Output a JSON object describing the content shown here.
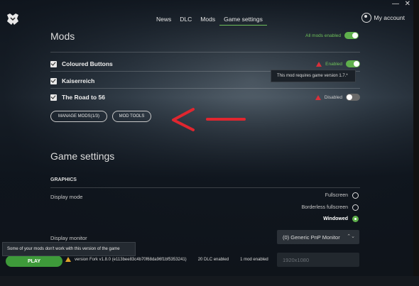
{
  "window": {
    "minimize": "—",
    "close": "✕"
  },
  "nav": {
    "items": [
      "News",
      "DLC",
      "Mods",
      "Game settings"
    ],
    "active": "Game settings",
    "account": "My account"
  },
  "mods": {
    "title": "Mods",
    "all_label": "All mods enabled",
    "list": [
      {
        "name": "Coloured Buttons",
        "status": "Enabled"
      },
      {
        "name": "Kaiserreich",
        "status": ""
      },
      {
        "name": "The Road to 56",
        "status": "Disabled"
      }
    ],
    "tooltip": "This mod requires game version 1.7.*",
    "manage_button": "MANAGE MODS(1/3)",
    "tools_button": "MOD TOOLS"
  },
  "settings": {
    "title": "Game settings",
    "section": "GRAPHICS",
    "display_mode_label": "Display mode",
    "display_modes": [
      "Fullscreen",
      "Borderless fullscreen",
      "Windowed"
    ],
    "selected_mode": "Windowed",
    "display_monitor_label": "Display monitor",
    "monitor_value": "(0) Generic PnP Monitor",
    "resolution_value": "1920x1080"
  },
  "bottom": {
    "warning_tooltip": "Some of your mods don't work with this version of the game",
    "play_button": "PLAY",
    "version": "version Fork v1.8.0 (e113bee83c4b70f68da96f1bf5353241)",
    "dlc": "20 DLC enabled",
    "mods_enabled": "1 mod enabled"
  },
  "colors": {
    "accent": "#5fb04c",
    "warning": "#d9303a",
    "arrow": "#e0262f"
  }
}
